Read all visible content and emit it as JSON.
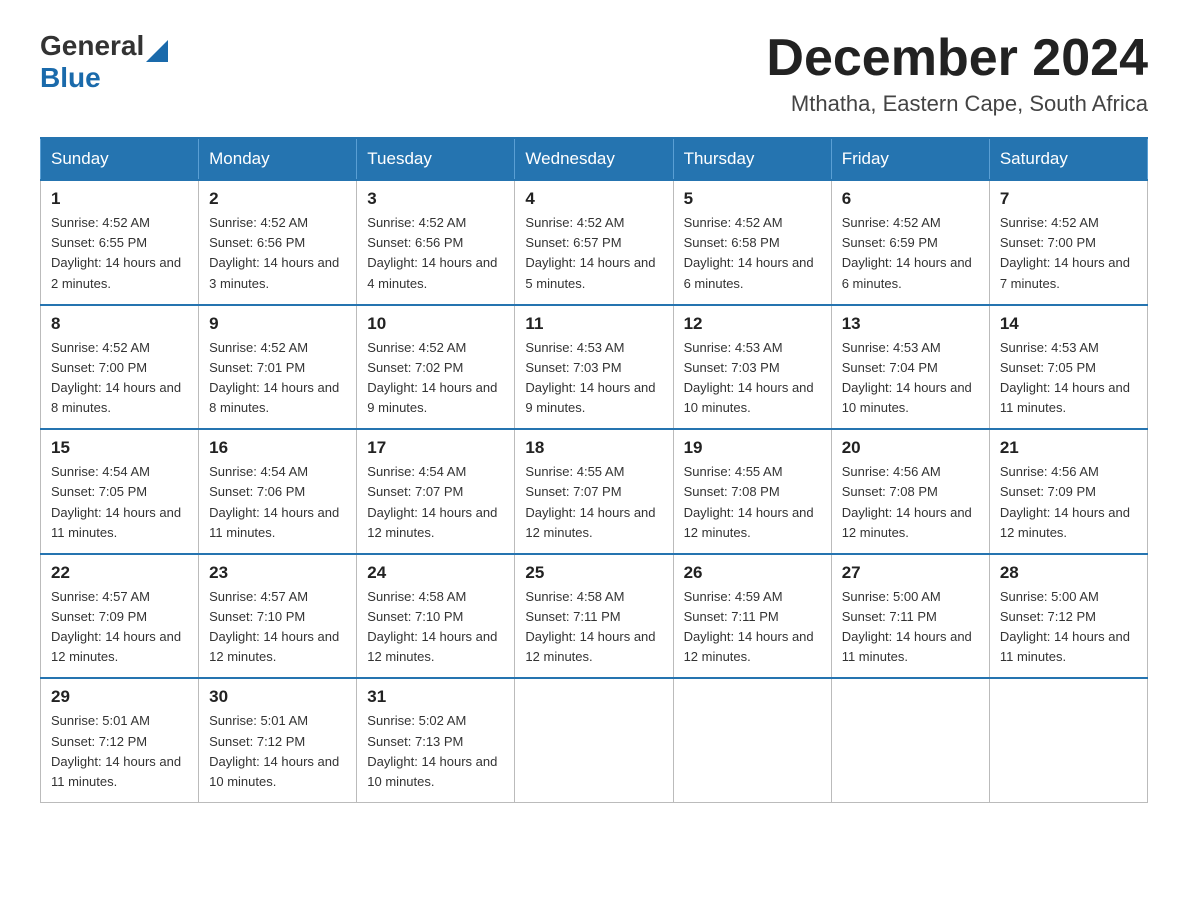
{
  "header": {
    "logo": {
      "general": "General",
      "blue": "Blue"
    },
    "month_title": "December 2024",
    "subtitle": "Mthatha, Eastern Cape, South Africa"
  },
  "weekdays": [
    "Sunday",
    "Monday",
    "Tuesday",
    "Wednesday",
    "Thursday",
    "Friday",
    "Saturday"
  ],
  "weeks": [
    [
      {
        "day": "1",
        "sunrise": "4:52 AM",
        "sunset": "6:55 PM",
        "daylight": "14 hours and 2 minutes."
      },
      {
        "day": "2",
        "sunrise": "4:52 AM",
        "sunset": "6:56 PM",
        "daylight": "14 hours and 3 minutes."
      },
      {
        "day": "3",
        "sunrise": "4:52 AM",
        "sunset": "6:56 PM",
        "daylight": "14 hours and 4 minutes."
      },
      {
        "day": "4",
        "sunrise": "4:52 AM",
        "sunset": "6:57 PM",
        "daylight": "14 hours and 5 minutes."
      },
      {
        "day": "5",
        "sunrise": "4:52 AM",
        "sunset": "6:58 PM",
        "daylight": "14 hours and 6 minutes."
      },
      {
        "day": "6",
        "sunrise": "4:52 AM",
        "sunset": "6:59 PM",
        "daylight": "14 hours and 6 minutes."
      },
      {
        "day": "7",
        "sunrise": "4:52 AM",
        "sunset": "7:00 PM",
        "daylight": "14 hours and 7 minutes."
      }
    ],
    [
      {
        "day": "8",
        "sunrise": "4:52 AM",
        "sunset": "7:00 PM",
        "daylight": "14 hours and 8 minutes."
      },
      {
        "day": "9",
        "sunrise": "4:52 AM",
        "sunset": "7:01 PM",
        "daylight": "14 hours and 8 minutes."
      },
      {
        "day": "10",
        "sunrise": "4:52 AM",
        "sunset": "7:02 PM",
        "daylight": "14 hours and 9 minutes."
      },
      {
        "day": "11",
        "sunrise": "4:53 AM",
        "sunset": "7:03 PM",
        "daylight": "14 hours and 9 minutes."
      },
      {
        "day": "12",
        "sunrise": "4:53 AM",
        "sunset": "7:03 PM",
        "daylight": "14 hours and 10 minutes."
      },
      {
        "day": "13",
        "sunrise": "4:53 AM",
        "sunset": "7:04 PM",
        "daylight": "14 hours and 10 minutes."
      },
      {
        "day": "14",
        "sunrise": "4:53 AM",
        "sunset": "7:05 PM",
        "daylight": "14 hours and 11 minutes."
      }
    ],
    [
      {
        "day": "15",
        "sunrise": "4:54 AM",
        "sunset": "7:05 PM",
        "daylight": "14 hours and 11 minutes."
      },
      {
        "day": "16",
        "sunrise": "4:54 AM",
        "sunset": "7:06 PM",
        "daylight": "14 hours and 11 minutes."
      },
      {
        "day": "17",
        "sunrise": "4:54 AM",
        "sunset": "7:07 PM",
        "daylight": "14 hours and 12 minutes."
      },
      {
        "day": "18",
        "sunrise": "4:55 AM",
        "sunset": "7:07 PM",
        "daylight": "14 hours and 12 minutes."
      },
      {
        "day": "19",
        "sunrise": "4:55 AM",
        "sunset": "7:08 PM",
        "daylight": "14 hours and 12 minutes."
      },
      {
        "day": "20",
        "sunrise": "4:56 AM",
        "sunset": "7:08 PM",
        "daylight": "14 hours and 12 minutes."
      },
      {
        "day": "21",
        "sunrise": "4:56 AM",
        "sunset": "7:09 PM",
        "daylight": "14 hours and 12 minutes."
      }
    ],
    [
      {
        "day": "22",
        "sunrise": "4:57 AM",
        "sunset": "7:09 PM",
        "daylight": "14 hours and 12 minutes."
      },
      {
        "day": "23",
        "sunrise": "4:57 AM",
        "sunset": "7:10 PM",
        "daylight": "14 hours and 12 minutes."
      },
      {
        "day": "24",
        "sunrise": "4:58 AM",
        "sunset": "7:10 PM",
        "daylight": "14 hours and 12 minutes."
      },
      {
        "day": "25",
        "sunrise": "4:58 AM",
        "sunset": "7:11 PM",
        "daylight": "14 hours and 12 minutes."
      },
      {
        "day": "26",
        "sunrise": "4:59 AM",
        "sunset": "7:11 PM",
        "daylight": "14 hours and 12 minutes."
      },
      {
        "day": "27",
        "sunrise": "5:00 AM",
        "sunset": "7:11 PM",
        "daylight": "14 hours and 11 minutes."
      },
      {
        "day": "28",
        "sunrise": "5:00 AM",
        "sunset": "7:12 PM",
        "daylight": "14 hours and 11 minutes."
      }
    ],
    [
      {
        "day": "29",
        "sunrise": "5:01 AM",
        "sunset": "7:12 PM",
        "daylight": "14 hours and 11 minutes."
      },
      {
        "day": "30",
        "sunrise": "5:01 AM",
        "sunset": "7:12 PM",
        "daylight": "14 hours and 10 minutes."
      },
      {
        "day": "31",
        "sunrise": "5:02 AM",
        "sunset": "7:13 PM",
        "daylight": "14 hours and 10 minutes."
      },
      null,
      null,
      null,
      null
    ]
  ],
  "labels": {
    "sunrise_prefix": "Sunrise: ",
    "sunset_prefix": "Sunset: ",
    "daylight_prefix": "Daylight: "
  }
}
